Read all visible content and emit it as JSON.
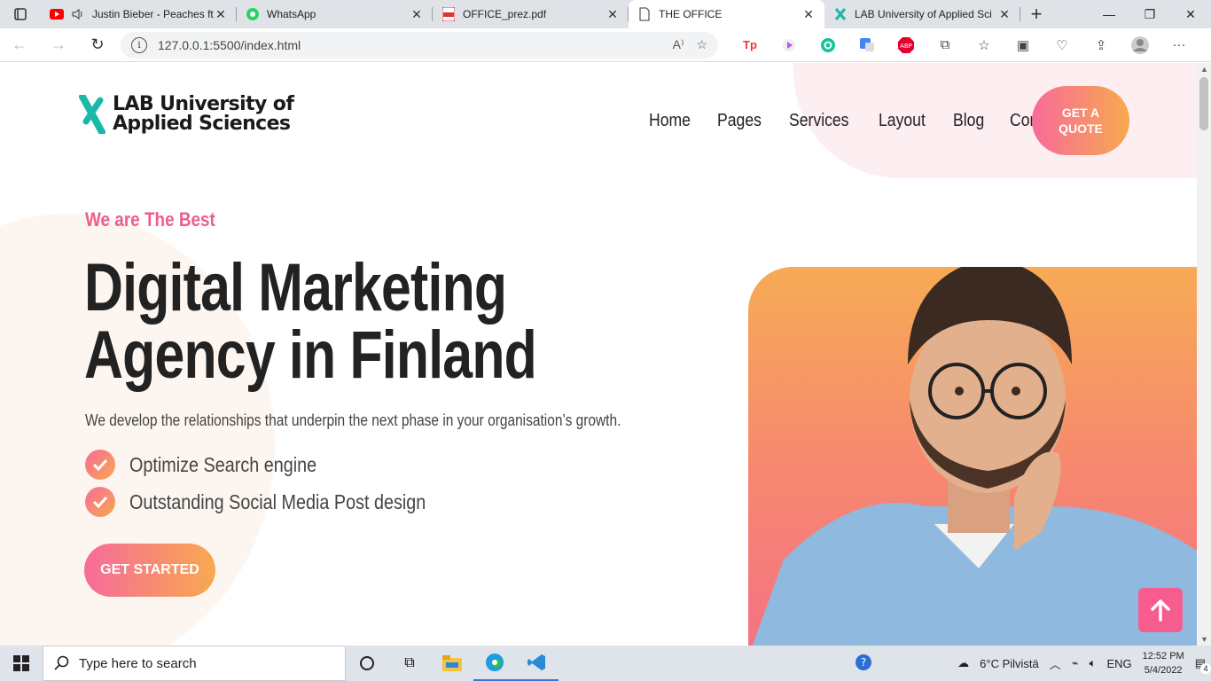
{
  "browser": {
    "tabs": [
      {
        "title": "Justin Bieber - Peaches ft. D",
        "icon": "youtube-icon",
        "audio": true
      },
      {
        "title": "WhatsApp",
        "icon": "whatsapp-icon"
      },
      {
        "title": "OFFICE_prez.pdf",
        "icon": "pdf-icon"
      },
      {
        "title": "THE OFFICE",
        "icon": "page-icon",
        "active": true
      },
      {
        "title": "LAB University of Applied Sci",
        "icon": "lab-icon"
      }
    ],
    "url": "127.0.0.1:5500/index.html"
  },
  "site": {
    "logo_line1": "LAB University of",
    "logo_line2": "Applied Sciences",
    "nav": [
      "Home",
      "Pages",
      "Services",
      "Layout",
      "Blog",
      "Contact"
    ],
    "quote_line1": "GET A",
    "quote_line2": "QUOTE",
    "eyebrow": "We are The Best",
    "headline_line1": "Digital Marketing",
    "headline_line2": "Agency in Finland",
    "subtitle": "We develop the relationships that underpin the next phase in your organisation’s growth.",
    "features": [
      "Optimize Search engine",
      "Outstanding Social Media Post design"
    ],
    "cta": "GET STARTED"
  },
  "taskbar": {
    "search_placeholder": "Type here to search",
    "weather": "6°C  Pilvistä",
    "lang": "ENG",
    "time": "12:52 PM",
    "date": "5/4/2022",
    "notifications": "4"
  },
  "colors": {
    "accent_pink": "#f76b9a",
    "accent_orange": "#f7a94e"
  }
}
